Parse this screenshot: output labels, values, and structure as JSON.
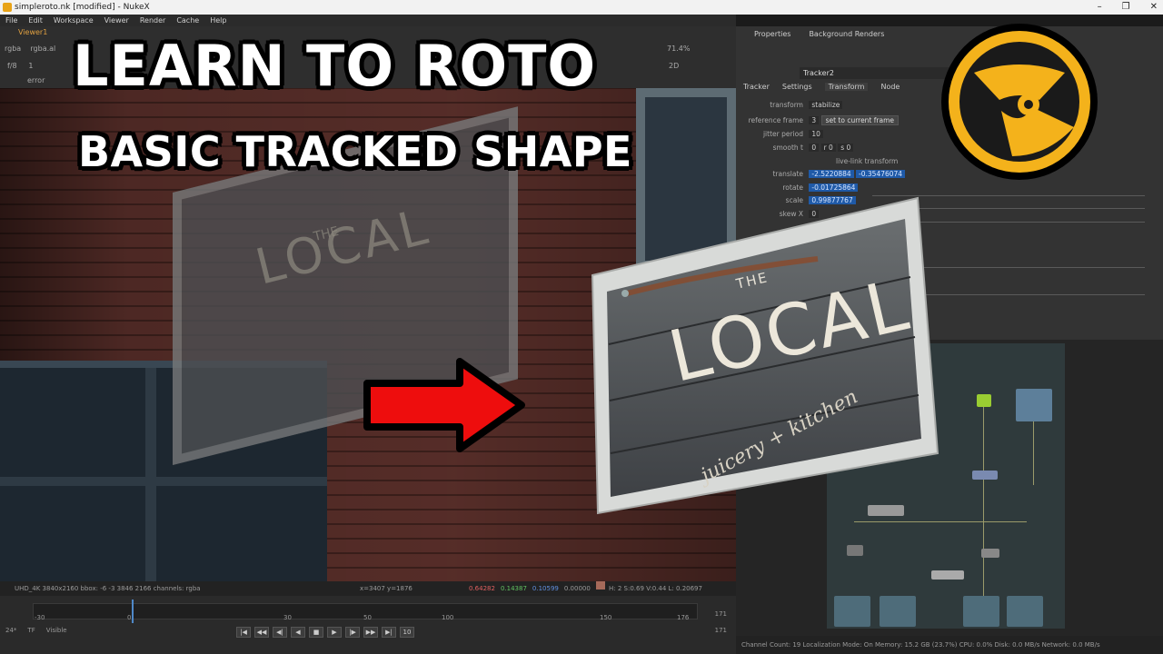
{
  "window": {
    "title": "simpleroto.nk [modified] - NukeX",
    "controls": [
      "–",
      "❐",
      "✕"
    ]
  },
  "menu": [
    "File",
    "Edit",
    "Workspace",
    "Viewer",
    "Render",
    "Cache",
    "Help"
  ],
  "viewer": {
    "tab": "Viewer1",
    "channel": "rgba",
    "channel2": "rgba.al",
    "fstop": "f/8",
    "frame": "1",
    "error": "error",
    "zoom": "71.4%",
    "proxy": "2D"
  },
  "info_bar": {
    "format": "UHD_4K 3840x2160  bbox: -6 -3 3846 2166 channels: rgba",
    "coords": "x=3407 y=1876",
    "r": "0.64282",
    "g": "0.14387",
    "b": "0.10599",
    "a": "0.00000",
    "hsv": "H: 2 S:0.69 V:0.44  L: 0.20697"
  },
  "timeline": {
    "ticks": [
      "-30",
      "0",
      "30",
      "50",
      "100",
      "150",
      "176"
    ],
    "fps": "24*",
    "tf": "TF",
    "visible": "Visible",
    "step": "10",
    "end_frame": "171",
    "end_frame2": "171",
    "current_frame": "1"
  },
  "properties": {
    "tabs": [
      "Properties",
      "Background Renders"
    ],
    "node_name": "Tracker2",
    "subtabs": [
      "Tracker",
      "Settings",
      "Transform",
      "Node"
    ],
    "active_subtab": "Transform",
    "transform": {
      "label": "transform",
      "value": "stabilize"
    },
    "reference_frame": {
      "label": "reference frame",
      "value": "3",
      "button": "set to current frame"
    },
    "jitter_period": {
      "label": "jitter period",
      "value": "10"
    },
    "smooth": {
      "label": "smooth t",
      "t": "0",
      "r": "r 0",
      "s": "s 0"
    },
    "live_link": "live-link transform",
    "translate": {
      "label": "translate",
      "x": "-2.5220884",
      "y": "-0.35476074"
    },
    "rotate": {
      "label": "rotate",
      "value": "-0.01725864"
    },
    "scale": {
      "label": "scale",
      "value": "0.99877767"
    },
    "skew": {
      "label": "skew X",
      "value": "0"
    }
  },
  "headline": {
    "line1": "LEARN TO ROTO",
    "line2": "BASIC  TRACKED SHAPE"
  },
  "sign": {
    "the": "THE",
    "local": "LOCAL",
    "tagline": "juicery + kitchen"
  },
  "status_bar": "Channel Count: 19  Localization Mode: On  Memory: 15.2 GB (23.7%)  CPU: 0.0%  Disk: 0.0 MB/s  Network: 0.0 MB/s",
  "colors": {
    "accent_orange": "#e8a317",
    "arrow_red": "#ee0d0d",
    "selection_blue": "#1f5aa8"
  }
}
